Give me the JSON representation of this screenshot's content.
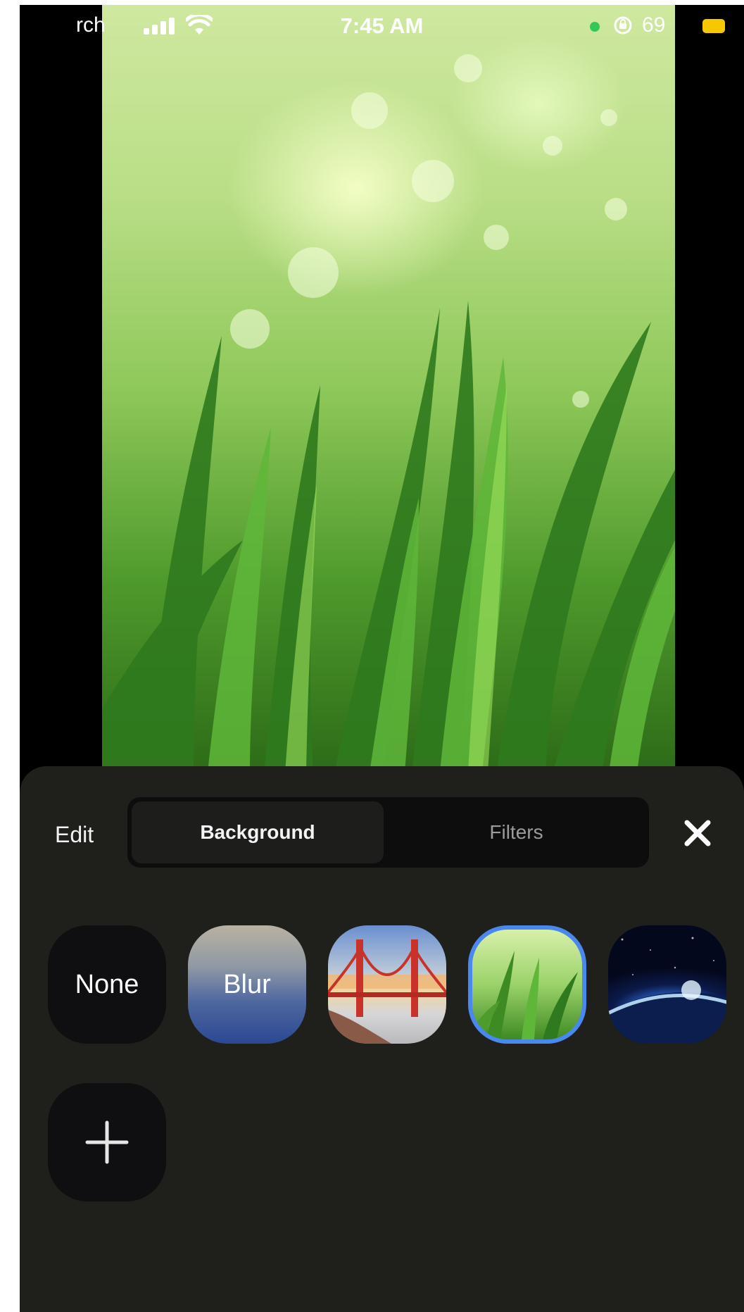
{
  "status_bar": {
    "carrier": "rch",
    "time": "7:45 AM",
    "battery_percent": "69",
    "icons": [
      "signal-icon",
      "wifi-icon",
      "camera-dot-icon",
      "rotation-lock-icon",
      "battery-icon"
    ],
    "battery_color": "#f6c800",
    "dot_color": "#33c759"
  },
  "preview": {
    "image": "grass-background"
  },
  "sheet": {
    "edit_label": "Edit",
    "tabs": [
      {
        "label": "Background",
        "active": true
      },
      {
        "label": "Filters",
        "active": false
      }
    ],
    "close_icon": "close-icon",
    "backgrounds": [
      {
        "label": "None",
        "selected": false
      },
      {
        "label": "Blur",
        "selected": false
      },
      {
        "label": "",
        "image": "golden-gate-bridge",
        "selected": false
      },
      {
        "label": "",
        "image": "grass",
        "selected": true
      },
      {
        "label": "",
        "image": "earth-from-space",
        "selected": false
      }
    ],
    "add_icon": "plus-icon",
    "selection_color": "#4a88f0"
  }
}
